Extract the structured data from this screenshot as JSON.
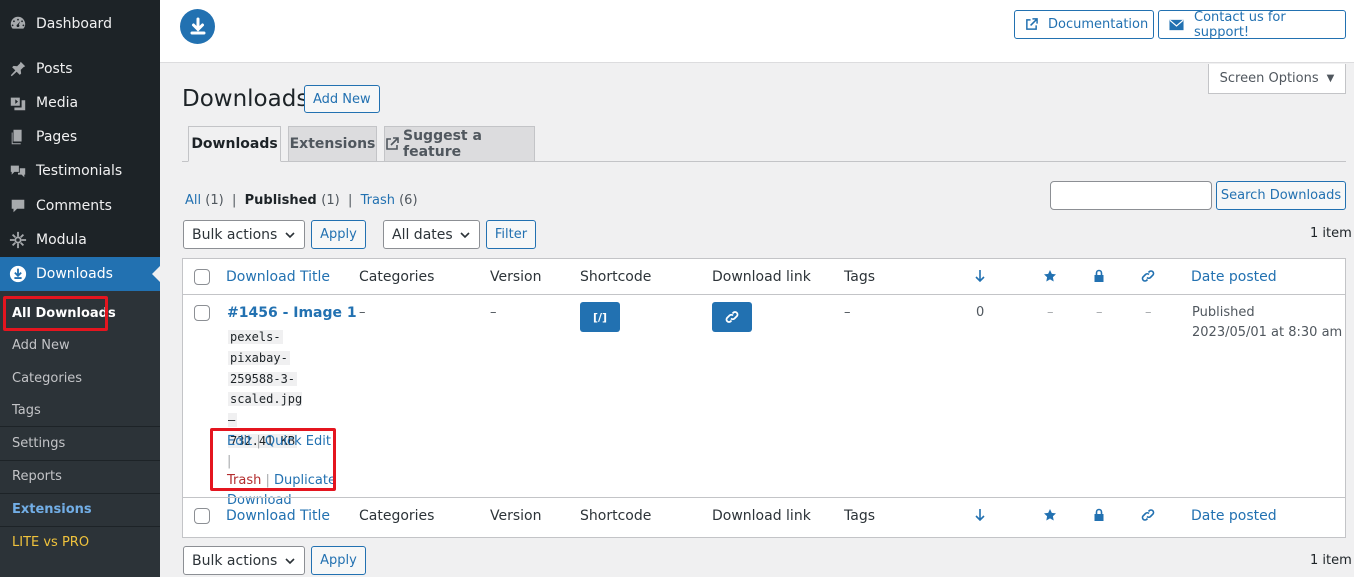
{
  "sidebar": {
    "menu": [
      {
        "label": "Dashboard",
        "icon": "dashboard-icon"
      },
      {
        "label": "Posts",
        "icon": "pin-icon"
      },
      {
        "label": "Media",
        "icon": "media-icon"
      },
      {
        "label": "Pages",
        "icon": "pages-icon"
      },
      {
        "label": "Testimonials",
        "icon": "testimonials-icon"
      },
      {
        "label": "Comments",
        "icon": "comment-icon"
      },
      {
        "label": "Modula",
        "icon": "modula-icon"
      },
      {
        "label": "Downloads",
        "icon": "download-icon"
      }
    ],
    "submenu": [
      {
        "label": "All Downloads"
      },
      {
        "label": "Add New"
      },
      {
        "label": "Categories"
      },
      {
        "label": "Tags"
      },
      {
        "label": "Settings"
      },
      {
        "label": "Reports"
      },
      {
        "label": "Extensions",
        "color": "#72aee6"
      },
      {
        "label": "LITE vs PRO",
        "color": "#f0c33c"
      }
    ]
  },
  "header": {
    "documentation": "Documentation",
    "contact": "Contact us for support!",
    "screen_options": "Screen Options"
  },
  "page": {
    "title": "Downloads",
    "add_new": "Add New"
  },
  "tabs": [
    {
      "label": "Downloads",
      "active": true
    },
    {
      "label": "Extensions"
    },
    {
      "label": "Suggest a feature"
    }
  ],
  "views": {
    "all": "All",
    "all_count": "(1)",
    "published": "Published",
    "published_count": "(1)",
    "trash": "Trash",
    "trash_count": "(6)"
  },
  "search": {
    "button": "Search Downloads",
    "placeholder": ""
  },
  "filters": {
    "bulk_actions": "Bulk actions",
    "apply": "Apply",
    "all_dates": "All dates",
    "filter": "Filter",
    "items_count": "1 item"
  },
  "table": {
    "columns": {
      "title": "Download Title",
      "categories": "Categories",
      "version": "Version",
      "shortcode": "Shortcode",
      "download_link": "Download link",
      "tags": "Tags",
      "date": "Date posted"
    },
    "row": {
      "title": "#1456 - Image 1",
      "file_lines": [
        "pexels-",
        "pixabay-",
        "259588-3-",
        "scaled.jpg –",
        "732.41 KB"
      ],
      "categories": "–",
      "version": "–",
      "shortcode_icon": "[/]",
      "tags": "–",
      "downloads": "0",
      "featured": "–",
      "locked": "–",
      "linked": "–",
      "status": "Published",
      "date": "2023/05/01 at 8:30 am",
      "actions": {
        "edit": "Edit",
        "quick_edit": "Quick Edit",
        "trash": "Trash",
        "duplicate": "Duplicate",
        "download": "Download",
        "sep": "|"
      }
    }
  },
  "colors": {
    "accent": "#2271b1",
    "sidebar_bg": "#1d2327",
    "highlight": "#e4151f",
    "trash": "#b32d2e"
  }
}
